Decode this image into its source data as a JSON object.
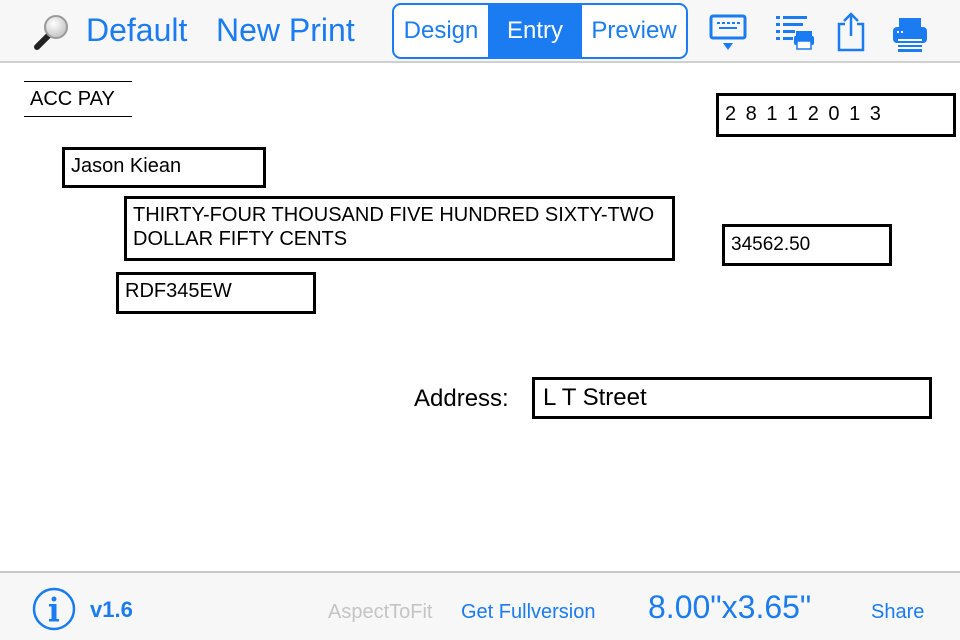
{
  "topbar": {
    "default_label": "Default",
    "new_print_label": "New Print",
    "segments": [
      {
        "label": "Design",
        "selected": false
      },
      {
        "label": "Entry",
        "selected": true
      },
      {
        "label": "Preview",
        "selected": false
      }
    ],
    "icons": [
      "keyboard-dismiss-icon",
      "list-print-icon",
      "share-icon",
      "printer-icon"
    ]
  },
  "check": {
    "acc_pay": "ACC PAY",
    "date": "2 8 1 1 2 0 1 3",
    "payee": "Jason Kiean",
    "amount_words": "THIRTY-FOUR THOUSAND FIVE HUNDRED SIXTY-TWO DOLLAR FIFTY CENTS",
    "amount_number": "34562.50",
    "reference": "RDF345EW",
    "address_label": "Address:",
    "address_value": "L T Street"
  },
  "bottombar": {
    "version": "v1.6",
    "aspect_label": "AspectToFit",
    "fullversion_label": "Get Fullversion",
    "size_label": "8.00\"x3.65\"",
    "share_label": "Share"
  },
  "colors": {
    "accent": "#1a7cf0",
    "disabled_text": "#c4c4c4"
  }
}
